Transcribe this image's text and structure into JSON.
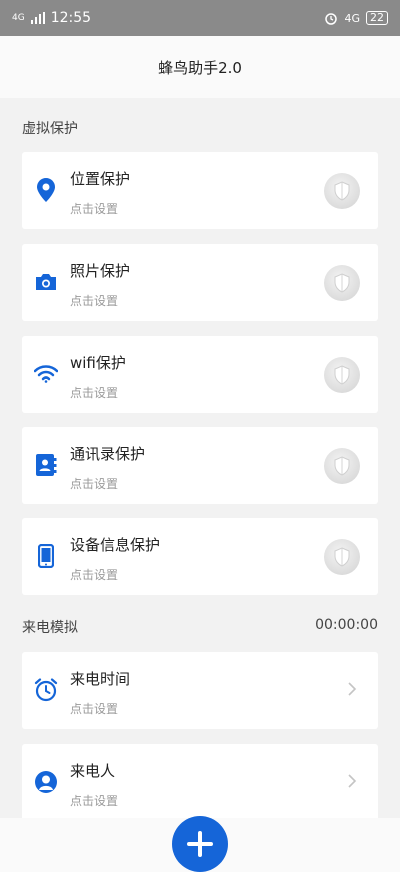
{
  "status_bar": {
    "network": "4G",
    "time": "12:55",
    "right_network": "4G",
    "battery": "22"
  },
  "header": {
    "title": "蜂鸟助手2.0"
  },
  "sections": {
    "virtual_protection": {
      "title": "虚拟保护"
    },
    "call_simulation": {
      "title": "来电模拟",
      "timer": "00:00:00"
    }
  },
  "protection_items": [
    {
      "title": "位置保护",
      "subtitle": "点击设置",
      "icon": "location-pin-icon"
    },
    {
      "title": "照片保护",
      "subtitle": "点击设置",
      "icon": "camera-icon"
    },
    {
      "title": "wifi保护",
      "subtitle": "点击设置",
      "icon": "wifi-icon"
    },
    {
      "title": "通讯录保护",
      "subtitle": "点击设置",
      "icon": "contacts-icon"
    },
    {
      "title": "设备信息保护",
      "subtitle": "点击设置",
      "icon": "phone-icon"
    }
  ],
  "call_items": [
    {
      "title": "来电时间",
      "subtitle": "点击设置",
      "icon": "alarm-clock-icon"
    },
    {
      "title": "来电人",
      "subtitle": "点击设置",
      "icon": "person-icon"
    }
  ],
  "colors": {
    "accent": "#1565d8",
    "background": "#f2f2f2",
    "card": "#ffffff",
    "subtext": "#9a9a9a"
  }
}
